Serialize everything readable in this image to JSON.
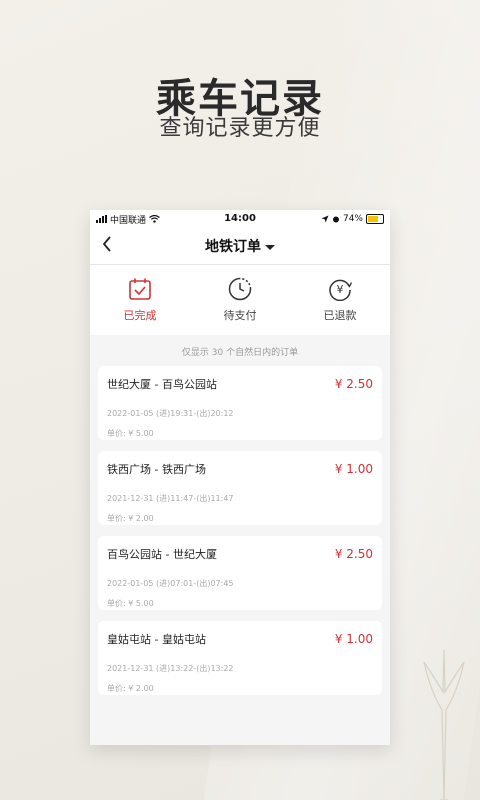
{
  "promo": {
    "title": "乘车记录",
    "subtitle": "查询记录更方便"
  },
  "status_bar": {
    "carrier": "中国联通",
    "time": "14:00",
    "battery": "74%"
  },
  "nav": {
    "title": "地铁订单"
  },
  "tabs": [
    {
      "label": "已完成",
      "icon": "calendar-check-icon",
      "active": true
    },
    {
      "label": "待支付",
      "icon": "clock-icon",
      "active": false
    },
    {
      "label": "已退款",
      "icon": "yuan-refund-icon",
      "active": false
    }
  ],
  "notice": "仅显示 30 个自然日内的订单",
  "orders": [
    {
      "route": "世纪大厦 - 百鸟公园站",
      "price": "¥ 2.50",
      "times": "2022-01-05 (进)19:31-(出)20:12",
      "unit_price": "单价: ¥ 5.00"
    },
    {
      "route": "铁西广场 - 铁西广场",
      "price": "¥ 1.00",
      "times": "2021-12-31 (进)11:47-(出)11:47",
      "unit_price": "单价: ¥ 2.00"
    },
    {
      "route": "百鸟公园站 - 世纪大厦",
      "price": "¥ 2.50",
      "times": "2022-01-05 (进)07:01-(出)07:45",
      "unit_price": "单价: ¥ 5.00"
    },
    {
      "route": "皇姑屯站 - 皇姑屯站",
      "price": "¥ 1.00",
      "times": "2021-12-31 (进)13:22-(出)13:22",
      "unit_price": "单价: ¥ 2.00"
    }
  ],
  "colors": {
    "accent": "#d63034",
    "background": "#f5f5f5"
  }
}
